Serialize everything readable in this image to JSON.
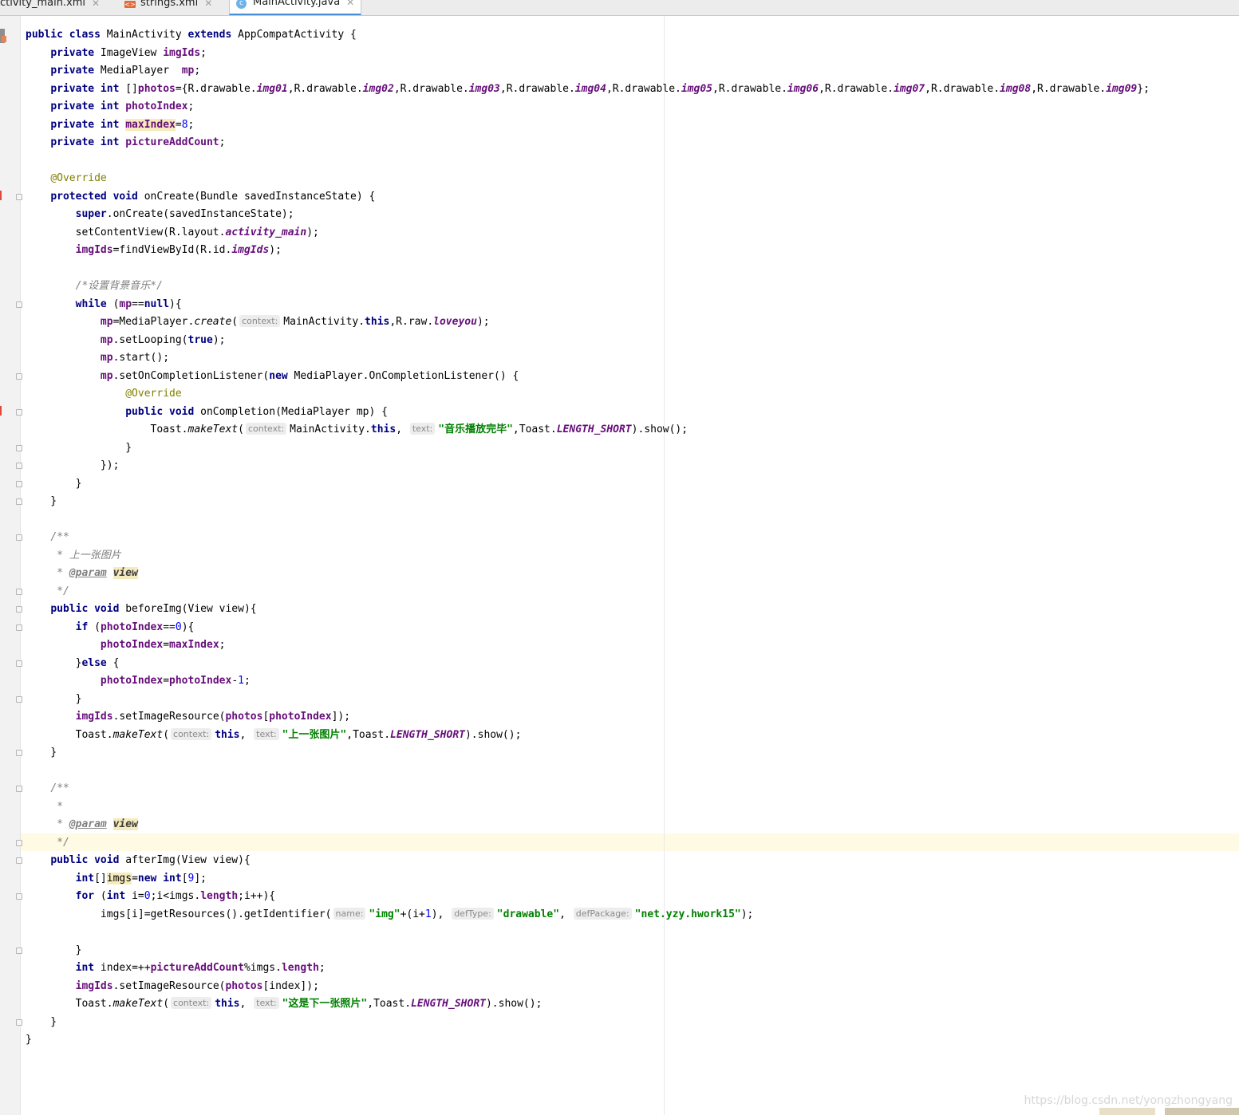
{
  "tabs": [
    {
      "label": "ctivity_main.xml",
      "active": false,
      "icon": "xml-file-icon"
    },
    {
      "label": "strings.xml",
      "active": false,
      "icon": "xml-file-icon"
    },
    {
      "label": "MainActivity.java",
      "active": true,
      "icon": "java-class-icon"
    }
  ],
  "hints": {
    "context": "context:",
    "text": "text:",
    "name": "name:",
    "defType": "defType:",
    "defPackage": "defPackage:"
  },
  "watermark": "https://blog.csdn.net/yongzhongyang",
  "colors": {
    "keyword": "#000080",
    "field": "#660e7a",
    "string": "#008000",
    "number": "#0000ff",
    "annotation": "#808000",
    "comment": "#808080",
    "caret_line": "#fffae3"
  }
}
